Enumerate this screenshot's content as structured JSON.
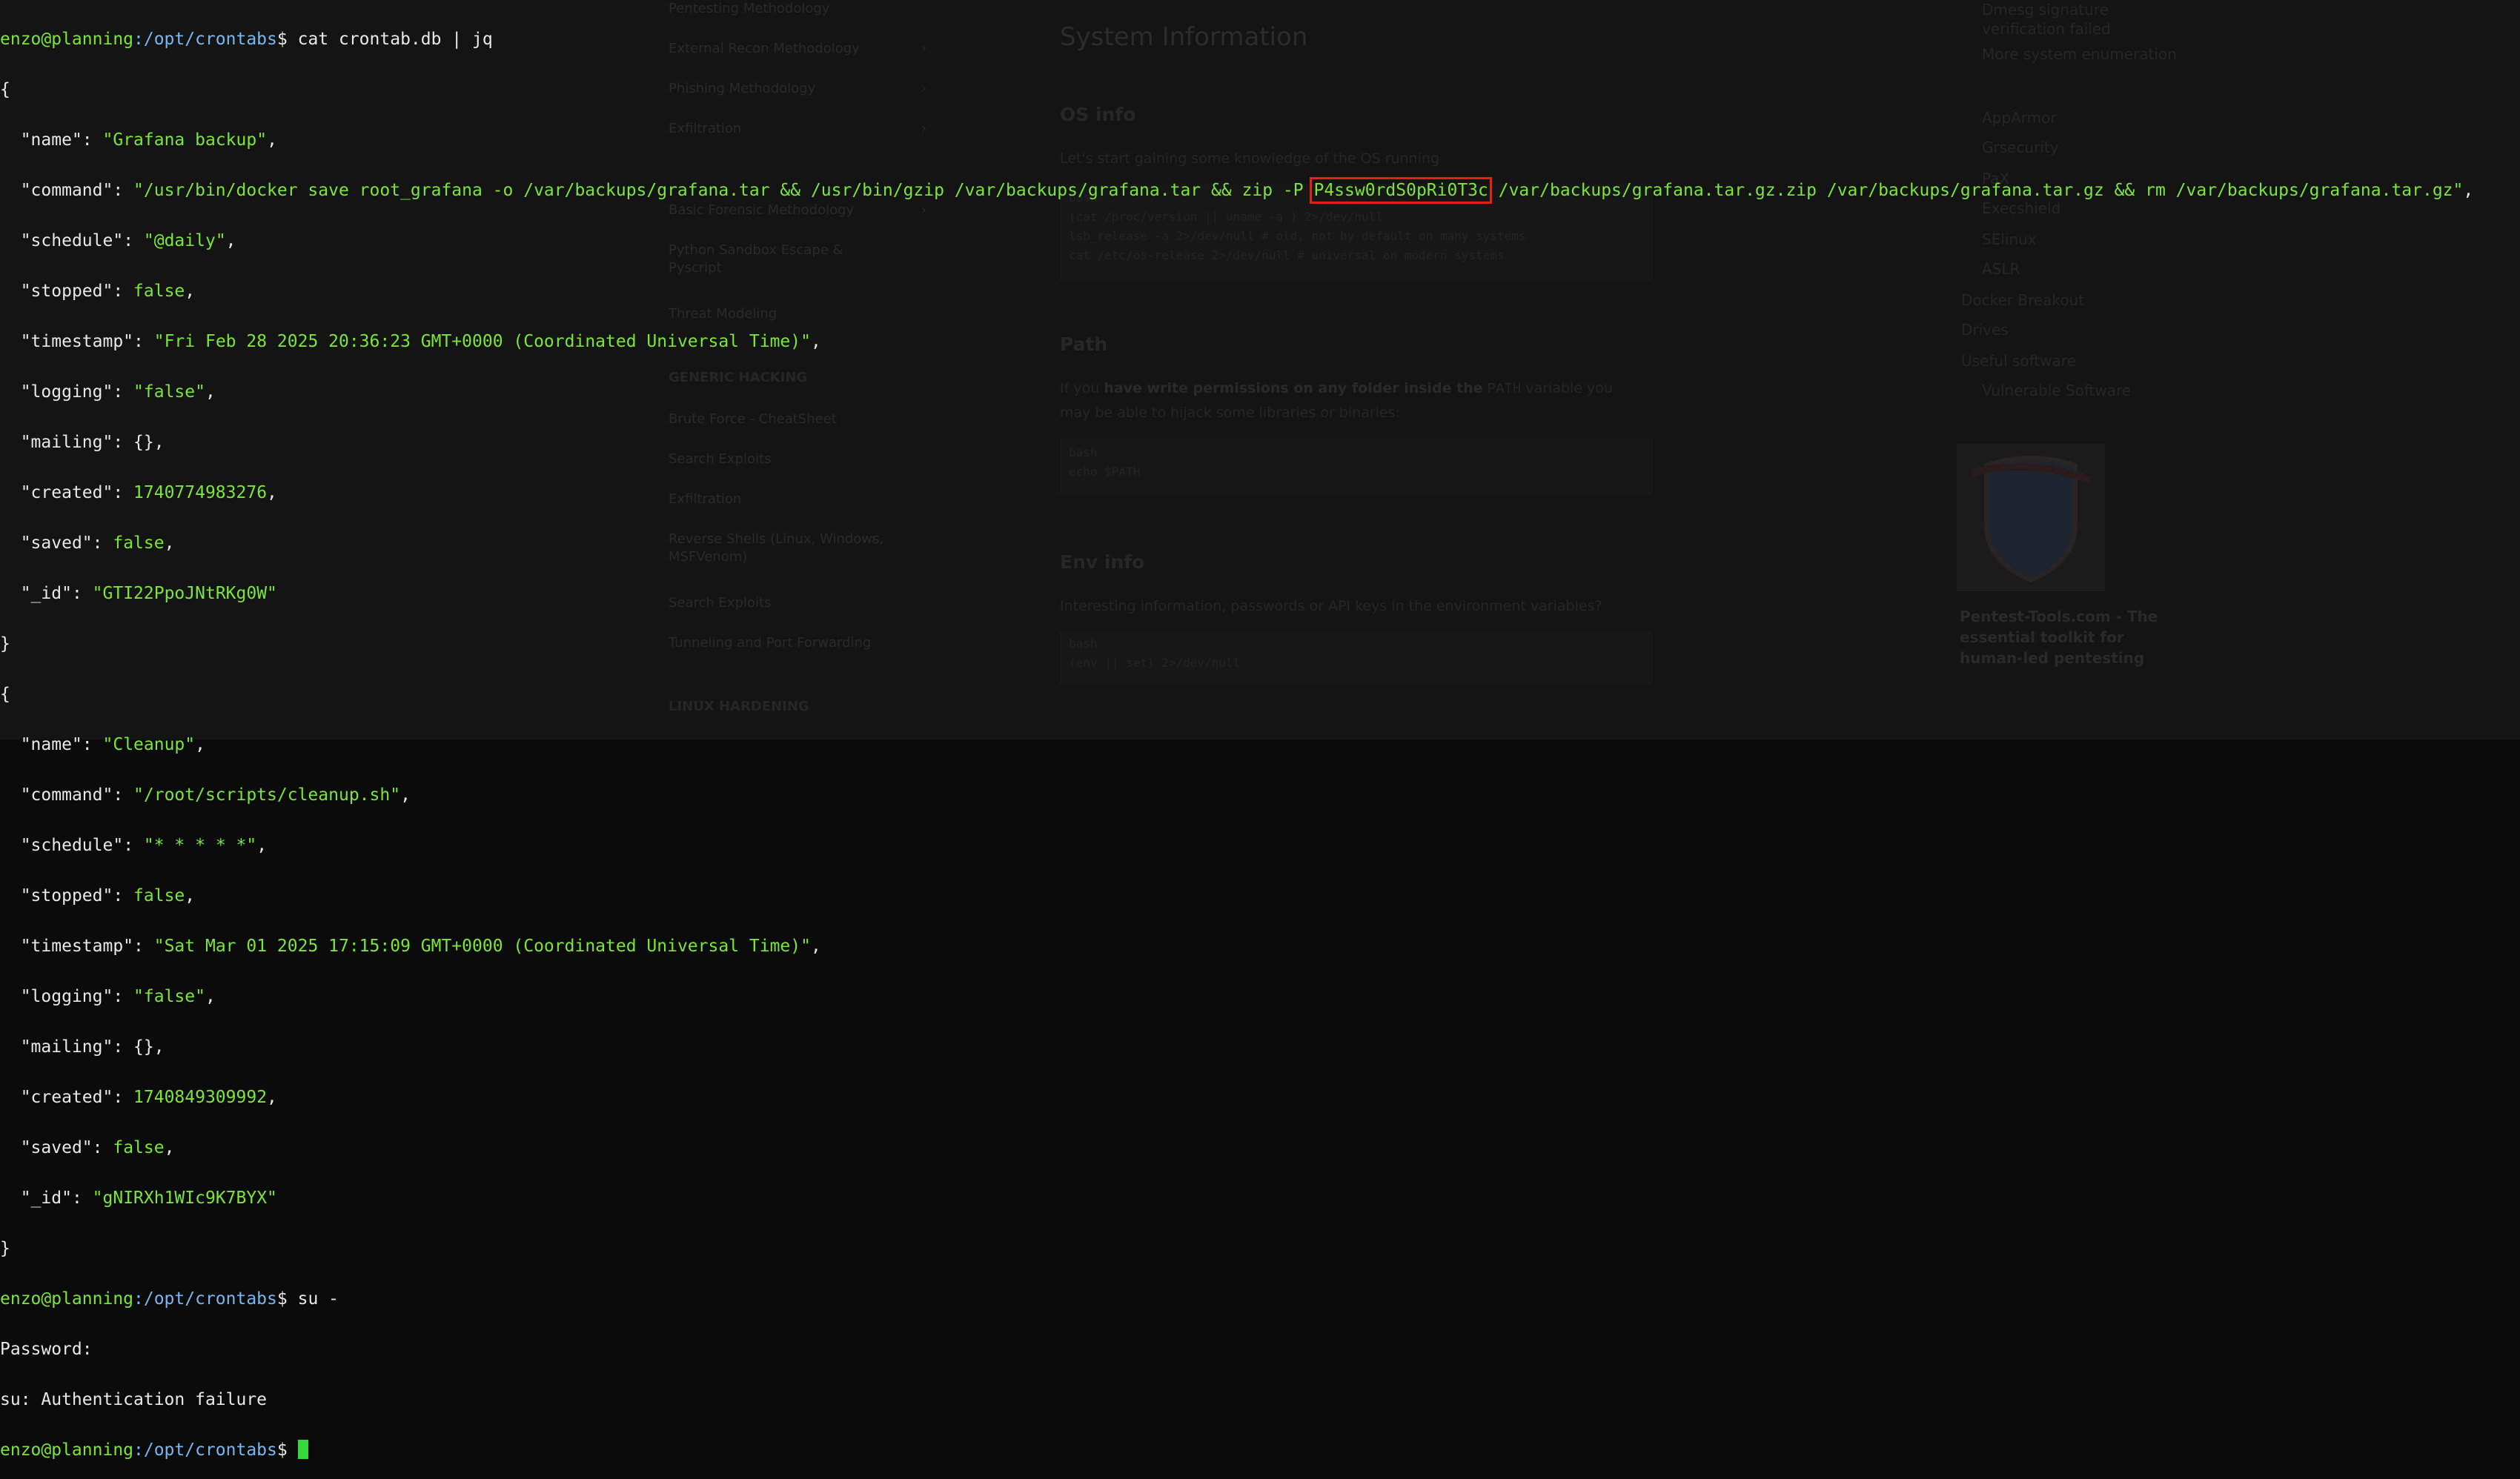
{
  "browser_page": {
    "sidebar": {
      "items": [
        "Pentesting Methodology",
        "External Recon Methodology",
        "Phishing Methodology",
        "Exfiltration",
        "Basic Forensic Methodology",
        "Python Sandbox Escape & Pyscript",
        "Threat Modeling",
        "GENERIC HACKING",
        "Brute Force - CheatSheet",
        "Search Exploits",
        "Exfiltration",
        "Reverse Shells (Linux, Windows, MSFVenom)",
        "Search Exploits",
        "Tunneling and Port Forwarding",
        "LINUX HARDENING"
      ]
    },
    "main": {
      "title": "System Information",
      "os_heading": "OS info",
      "os_text": "Let's start gaining some knowledge of the OS running",
      "os_code_lang": "bash",
      "os_code": [
        "(cat /proc/version || uname -a ) 2>/dev/null",
        "lsb_release -a 2>/dev/null # old, not by default on many systems",
        "cat /etc/os-release 2>/dev/null # universal on modern systems"
      ],
      "path_heading": "Path",
      "path_text_1": "If you ",
      "path_text_bold": "have write permissions on any folder inside the",
      "path_text_code": "PATH",
      "path_text_2": " variable you may be able to hijack some libraries or binaries:",
      "path_code_lang": "bash",
      "path_code": "echo $PATH",
      "env_heading": "Env info",
      "env_text": "Interesting information, passwords or API keys in the environment variables?",
      "env_code_lang": "bash",
      "env_code": "(env || set) 2>/dev/null"
    },
    "toc": [
      "Dmesg signature verification failed",
      "More system enumeration",
      "AppArmor",
      "Grsecurity",
      "PaX",
      "Execshield",
      "SElinux",
      "ASLR",
      "Docker Breakout",
      "Drives",
      "Useful software",
      "Vulnerable Software"
    ],
    "ad": {
      "title": "Pentest-Tools.com - The essential toolkit for human-led pentesting"
    }
  },
  "terminal": {
    "prompt_user": "enzo@planning",
    "prompt_path": ":/opt/crontabs",
    "prompt_symbol": "$ ",
    "command_1": "cat crontab.db | jq",
    "records": [
      {
        "name": "\"Grafana backup\"",
        "command_pre": "\"/usr/bin/docker save root_grafana -o /var/backups/grafana.tar && /usr/bin/gzip /var/backups/grafana.tar && zip -P",
        "command_secret": "P4ssw0rdS0pRi0T3c",
        "command_post": "/var/backups/grafana.tar.gz.zip /var/backups/grafana.tar.gz && rm /var/backups/grafana.tar.gz\"",
        "schedule": "\"@daily\"",
        "stopped": "false",
        "timestamp": "\"Fri Feb 28 2025 20:36:23 GMT+0000 (Coordinated Universal Time)\"",
        "logging": "\"false\"",
        "mailing": "{}",
        "created": "1740774983276",
        "saved": "false",
        "id": "\"GTI22PpoJNtRKg0W\""
      },
      {
        "name": "\"Cleanup\"",
        "command": "\"/root/scripts/cleanup.sh\"",
        "schedule": "\"* * * * *\"",
        "stopped": "false",
        "timestamp": "\"Sat Mar 01 2025 17:15:09 GMT+0000 (Coordinated Universal Time)\"",
        "logging": "\"false\"",
        "mailing": "{}",
        "created": "1740849309992",
        "saved": "false",
        "id": "\"gNIRXh1WIc9K7BYX\""
      }
    ],
    "command_2": "su -",
    "password_prompt": "Password:",
    "auth_failure": "su: Authentication failure"
  },
  "colors": {
    "prompt": "#7ce53c",
    "path": "#7ab6f0",
    "highlight_box": "#e0231a",
    "cursor": "#37d93a"
  }
}
